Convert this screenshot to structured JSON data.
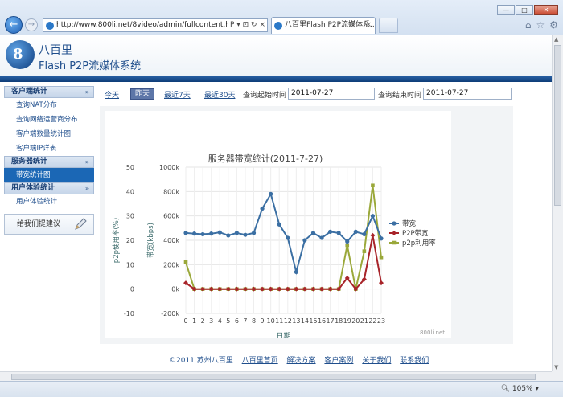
{
  "browser": {
    "url": "http://www.800li.net/8video/admin/fullcontent.html",
    "addr_tools": "P ▾ ⊡ ↻ ×",
    "tab_title": "八百里Flash P2P流媒体系...",
    "tab_close": "×",
    "zoom": "105%",
    "win_min": "—",
    "win_max": "□",
    "win_close": "✕"
  },
  "header": {
    "logo_char": "8",
    "brand_cn": "八百里",
    "brand_en": "Flash P2P流媒体系统"
  },
  "sidebar": {
    "sections": [
      {
        "title": "客户端统计",
        "items": [
          "查询NAT分布",
          "查询网络运营商分布",
          "客户端数量统计图",
          "客户端IP详表"
        ]
      },
      {
        "title": "服务器统计",
        "items": [
          "带宽统计图"
        ]
      },
      {
        "title": "用户体验统计",
        "items": [
          "用户体验统计"
        ]
      }
    ],
    "suggest": "给我们提建议"
  },
  "toolbar": {
    "today": "今天",
    "yesterday": "昨天",
    "last7": "最近7天",
    "last30": "最近30天",
    "start_label": "查询起始时间",
    "start_value": "2011-07-27",
    "end_label": "查询结束时间",
    "end_value": "2011-07-27"
  },
  "chart_data": {
    "type": "line",
    "title": "服务器带宽统计(2011-7-27)",
    "xlabel": "日期",
    "ylabel_left": "p2p使用率(%)",
    "ylabel_right": "带宽(kbps)",
    "x": [
      "0",
      "1",
      "2",
      "3",
      "4",
      "5",
      "6",
      "7",
      "8",
      "9",
      "10",
      "11",
      "12",
      "13",
      "14",
      "15",
      "16",
      "17",
      "18",
      "19",
      "20",
      "21",
      "22",
      "23"
    ],
    "left_ticks": [
      "50",
      "40",
      "30",
      "20",
      "10",
      "0",
      "-10"
    ],
    "right_ticks": [
      "1000k",
      "800k",
      "600k",
      "400k",
      "200k",
      "0k",
      "-200k"
    ],
    "ylim": [
      -200,
      1000
    ],
    "series": [
      {
        "name": "带宽",
        "color": "#3b6fa3",
        "marker": "circle",
        "values": [
          460,
          455,
          450,
          455,
          465,
          440,
          460,
          445,
          460,
          660,
          780,
          530,
          420,
          140,
          400,
          460,
          420,
          470,
          460,
          390,
          470,
          450,
          600,
          415
        ]
      },
      {
        "name": "P2P带宽",
        "color": "#a8242a",
        "marker": "diamond",
        "values": [
          50,
          0,
          0,
          0,
          0,
          0,
          0,
          0,
          0,
          0,
          0,
          0,
          0,
          0,
          0,
          0,
          0,
          0,
          0,
          90,
          0,
          80,
          440,
          50
        ]
      },
      {
        "name": "p2p利用率",
        "color": "#9aa83a",
        "marker": "square",
        "values": [
          220,
          0,
          0,
          0,
          0,
          0,
          0,
          0,
          0,
          0,
          0,
          0,
          0,
          0,
          0,
          0,
          0,
          0,
          0,
          360,
          0,
          310,
          850,
          260
        ]
      }
    ],
    "legend": "right",
    "grid": true,
    "watermark": "800li.net"
  },
  "footer": {
    "copyright": "©2011 苏州八百里",
    "links": [
      "八百里首页",
      "解决方案",
      "客户案例",
      "关于我们",
      "联系我们"
    ]
  }
}
